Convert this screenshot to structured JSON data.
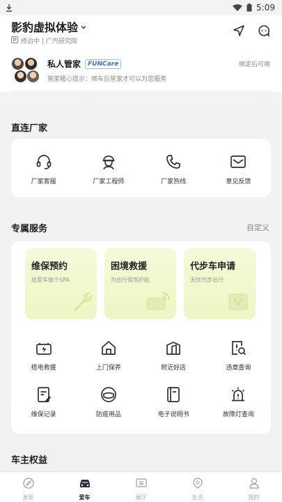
{
  "status_bar": {
    "time": "5:09"
  },
  "header": {
    "title": "影豹虚拟体验",
    "subtitle": "修泊中 | 广汽研究院"
  },
  "butler": {
    "name": "私人管家",
    "badge": "FUNCare",
    "tip": "管家暖心提示：绑车后管家才可以为您服务",
    "right_text": "绑定后可用"
  },
  "direct_factory": {
    "title": "直连厂家",
    "items": [
      {
        "label": "厂家客服",
        "icon": "headset-icon"
      },
      {
        "label": "厂家工程师",
        "icon": "engineer-icon"
      },
      {
        "label": "厂家热线",
        "icon": "phone-icon"
      },
      {
        "label": "意见反馈",
        "icon": "mail-icon"
      }
    ]
  },
  "exclusive_service": {
    "title": "专属服务",
    "customize_label": "自定义",
    "promos": [
      {
        "title": "维保预约",
        "subtitle": "给爱车做个SPA"
      },
      {
        "title": "困境救援",
        "subtitle": "为出行保驾护航"
      },
      {
        "title": "代步车申请",
        "subtitle": "无忧代步出行"
      }
    ],
    "items": [
      {
        "label": "搭电救援",
        "icon": "battery-charge-icon"
      },
      {
        "label": "上门保养",
        "icon": "home-service-icon"
      },
      {
        "label": "附近好店",
        "icon": "store-icon"
      },
      {
        "label": "违章查询",
        "icon": "violation-search-icon"
      },
      {
        "label": "维保记录",
        "icon": "maintenance-record-icon"
      },
      {
        "label": "防疫用品",
        "icon": "mask-icon"
      },
      {
        "label": "电子说明书",
        "icon": "manual-icon"
      },
      {
        "label": "故障灯查询",
        "icon": "warning-light-icon"
      }
    ]
  },
  "owner_rights": {
    "title": "车主权益"
  },
  "tab_bar": {
    "active": "爱车",
    "items": [
      {
        "label": "发现",
        "icon": "discover-icon"
      },
      {
        "label": "爱车",
        "icon": "car-icon"
      },
      {
        "label": "展厅",
        "icon": "showroom-icon"
      },
      {
        "label": "生活",
        "icon": "life-icon"
      },
      {
        "label": "我的",
        "icon": "profile-icon"
      }
    ]
  },
  "colors": {
    "accent": "#3a6fd8",
    "promo_bg": "#f1f8cf",
    "icon_stroke": "#2a2f3a"
  }
}
